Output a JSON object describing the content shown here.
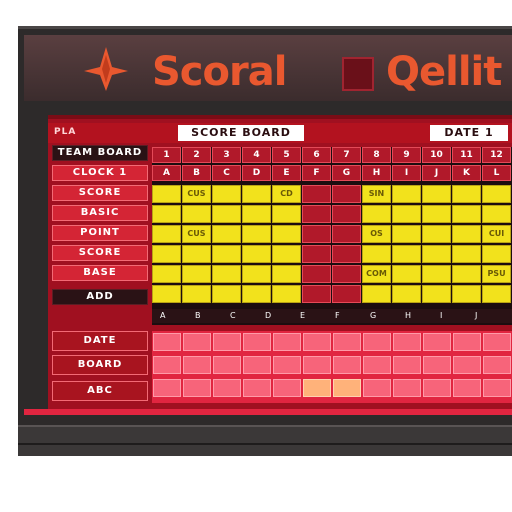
{
  "header": {
    "brand_left": "Scoral",
    "brand_right": "Qellit",
    "logo_icon": "star-burst-icon",
    "accent_color": "#e9582f"
  },
  "top_bar": {
    "left_tag": "PLA",
    "center_label": "SCORE BOARD",
    "right_label": "DATE 1"
  },
  "sidebar": {
    "items": [
      {
        "label": "TEAM BOARD"
      },
      {
        "label": "CLOCK 1"
      },
      {
        "label": "SCORE"
      },
      {
        "label": "BASIC"
      },
      {
        "label": "POINT"
      },
      {
        "label": "SCORE"
      },
      {
        "label": "BASE"
      },
      {
        "label": "ADD"
      }
    ]
  },
  "grid": {
    "headers": [
      "1",
      "2",
      "3",
      "4",
      "5",
      "6",
      "7",
      "8",
      "9",
      "10",
      "11",
      "12"
    ],
    "subheaders": [
      "A",
      "B",
      "C",
      "D",
      "E",
      "F",
      "G",
      "H",
      "I",
      "J",
      "K",
      "L"
    ],
    "rows": [
      [
        "",
        "CUS",
        "",
        "",
        "CD",
        "",
        "",
        "SIN",
        "",
        "",
        "",
        ""
      ],
      [
        "",
        "",
        "",
        "",
        "",
        "",
        "",
        "",
        "",
        "",
        "",
        ""
      ],
      [
        "",
        "CUS",
        "",
        "",
        "",
        "",
        "",
        "OS",
        "",
        "",
        "",
        "CUI"
      ],
      [
        "",
        "",
        "",
        "",
        "",
        "",
        "",
        "",
        "",
        "",
        "",
        ""
      ],
      [
        "",
        "",
        "",
        "",
        "",
        "",
        "",
        "COM",
        "",
        "",
        "",
        "PSU"
      ],
      [
        "",
        "",
        "",
        "",
        "",
        "",
        "",
        "",
        "",
        "",
        "",
        ""
      ]
    ],
    "footer_marks": [
      "A",
      "B",
      "C",
      "D",
      "E",
      "F",
      "G",
      "H",
      "I",
      "J"
    ]
  },
  "lower": {
    "labels": [
      {
        "label": "DATE"
      },
      {
        "label": "BOARD"
      },
      {
        "label": "ABC"
      }
    ]
  }
}
